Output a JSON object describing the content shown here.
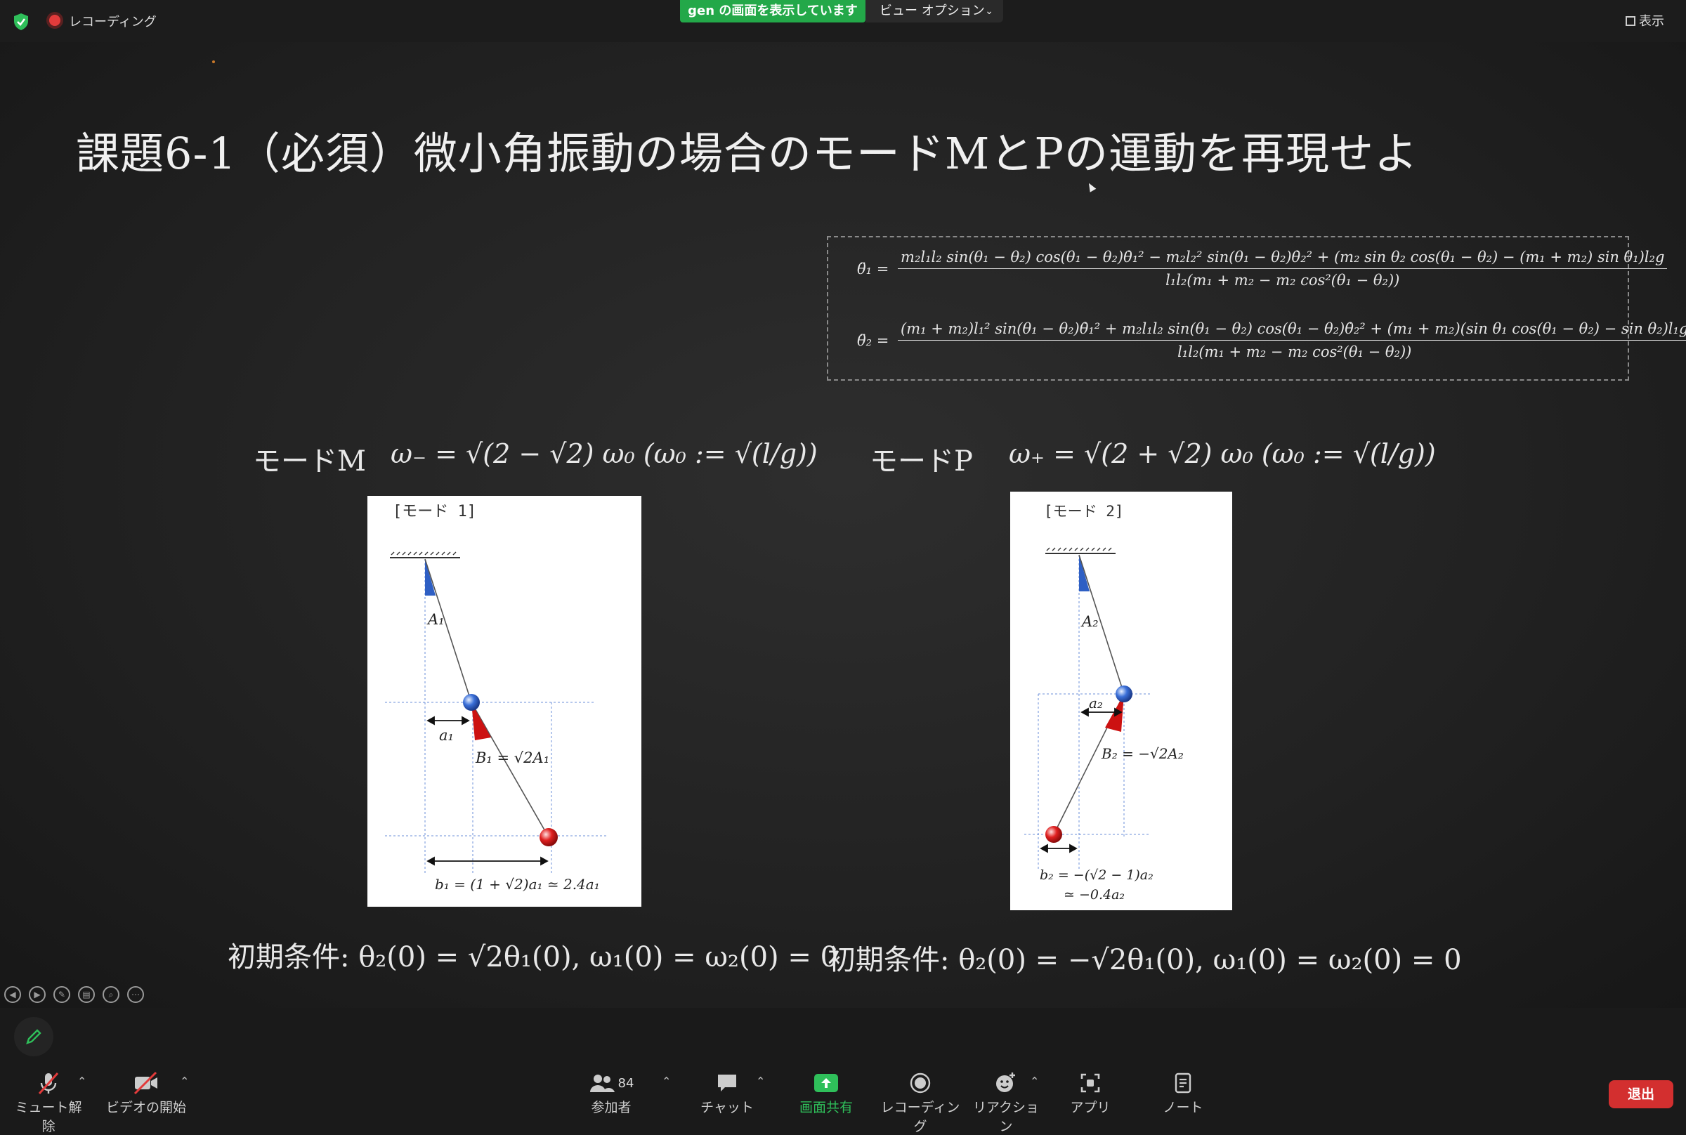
{
  "topbar": {
    "recording_label": "レコーディング",
    "share_banner": "gen の画面を表示しています",
    "view_options": "ビュー オプション",
    "view_toggle": "表示"
  },
  "slide": {
    "title": "課題6-1（必須）微小角振動の場合のモードMとPの運動を再現せよ",
    "eq1_lhs": "θ̈₁ =",
    "eq1_num": "m₂l₁l₂ sin(θ₁ − θ₂) cos(θ₁ − θ₂)θ̇₁² − m₂l₂² sin(θ₁ − θ₂)θ̇₂² + (m₂ sin θ₂ cos(θ₁ − θ₂) − (m₁ + m₂) sin θ₁)l₂g",
    "eq1_den": "l₁l₂(m₁ + m₂ − m₂ cos²(θ₁ − θ₂))",
    "eq2_lhs": "θ̈₂ =",
    "eq2_num": "(m₁ + m₂)l₁² sin(θ₁ − θ₂)θ̇₁² + m₂l₁l₂ sin(θ₁ − θ₂) cos(θ₁ − θ₂)θ̇₂² + (m₁ + m₂)(sin θ₁ cos(θ₁ − θ₂) − sin θ₂)l₁g",
    "eq2_den": "l₁l₂(m₁ + m₂ − m₂ cos²(θ₁ − θ₂))",
    "modeM_label": "モードM",
    "modeM_formula": "ω₋ = √(2 − √2) ω₀   (ω₀ := √(l/g))",
    "modeP_label": "モードP",
    "modeP_formula": "ω₊ = √(2 + √2) ω₀   (ω₀ := √(l/g))",
    "fig1": {
      "label": "[モード 1]",
      "A": "A₁",
      "a": "a₁",
      "B": "B₁ = √2A₁",
      "b": "b₁ = (1 + √2)a₁ ≃ 2.4a₁"
    },
    "fig2": {
      "label": "[モード 2]",
      "A": "A₂",
      "a": "a₂",
      "B": "B₂ = −√2A₂",
      "b1": "b₂ = −(√2 − 1)a₂",
      "b2": "≃ −0.4a₂"
    },
    "init_left": "初期条件: θ₂(0) = √2θ₁(0), ω₁(0) = ω₂(0) = 0",
    "init_right": "初期条件: θ₂(0) = −√2θ₁(0), ω₁(0) = ω₂(0) = 0"
  },
  "toolbar": {
    "mute": "ミュート解除",
    "video": "ビデオの開始",
    "participants": "参加者",
    "participants_count": "84",
    "chat": "チャット",
    "share": "画面共有",
    "record": "レコーディング",
    "reactions": "リアクション",
    "apps": "アプリ",
    "notes": "ノート",
    "exit": "退出"
  },
  "colors": {
    "share_green": "#23a849",
    "exit_red": "#d32f2f",
    "accent_green": "#2fbf5a"
  }
}
